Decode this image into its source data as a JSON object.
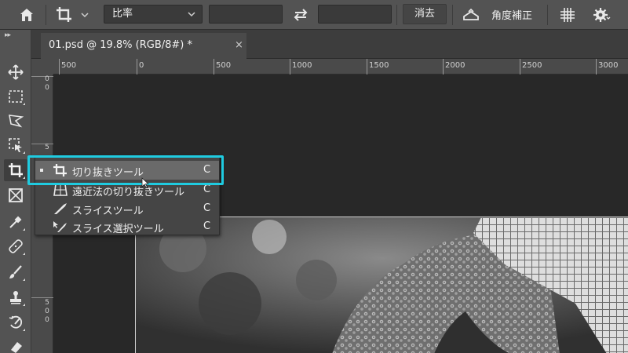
{
  "options_bar": {
    "ratio_select": "比率",
    "width_value": "",
    "height_value": "",
    "clear_button": "消去",
    "straighten_label": "角度補正"
  },
  "document": {
    "tab_title": "01.psd @ 19.8% (RGB/8#) *",
    "close_label": "×"
  },
  "ruler": {
    "h_labels": [
      "500",
      "0",
      "500",
      "1000",
      "1500",
      "2000",
      "2500",
      "3000"
    ],
    "v_labels": [
      "0 0",
      "5",
      "5 0 0"
    ]
  },
  "flyout": {
    "items": [
      {
        "label": "切り抜きツール",
        "shortcut": "C",
        "selected": true,
        "icon": "crop-icon"
      },
      {
        "label": "遠近法の切り抜きツール",
        "shortcut": "C",
        "selected": false,
        "icon": "perspective-crop-icon"
      },
      {
        "label": "スライスツール",
        "shortcut": "C",
        "selected": false,
        "icon": "slice-icon"
      },
      {
        "label": "スライス選択ツール",
        "shortcut": "C",
        "selected": false,
        "icon": "slice-select-icon"
      }
    ]
  },
  "colors": {
    "highlight": "#1fcbe0",
    "panel": "#535353",
    "canvas": "#282828"
  }
}
